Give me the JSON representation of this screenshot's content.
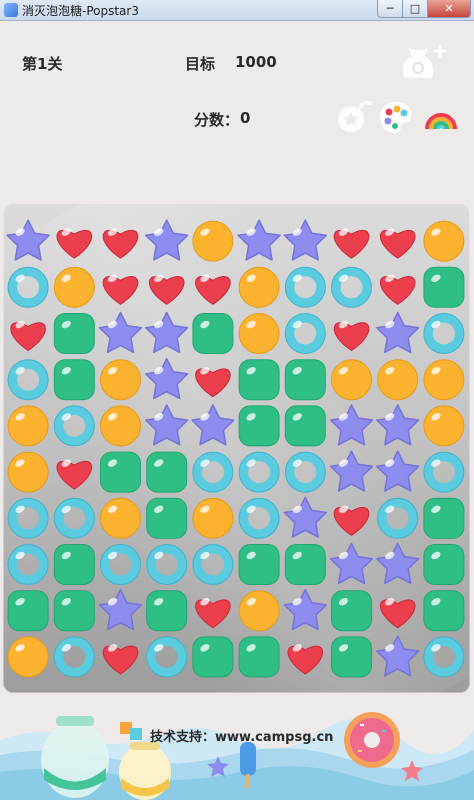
{
  "window": {
    "title": "消灭泡泡糖-Popstar3",
    "minimize_label": "─",
    "maximize_label": "□",
    "close_label": "✕"
  },
  "header": {
    "level": "第1关",
    "target_label": "目标",
    "target_value": "1000",
    "score_label": "分数：",
    "score_value": "0"
  },
  "tools": [
    {
      "name": "coin-bag-add-icon"
    },
    {
      "name": "bomb-icon"
    },
    {
      "name": "palette-icon"
    },
    {
      "name": "rainbow-icon"
    }
  ],
  "footer": {
    "credit": "技术支持：www.campsg.cn"
  },
  "colors": {
    "star": "#8f8cf0",
    "heart": "#ec3f4e",
    "orange": "#fbb22e",
    "ring": "#5bcbe0",
    "square": "#2fbf86"
  },
  "board": {
    "legend": {
      "S": "star",
      "H": "heart",
      "O": "orange",
      "R": "ring",
      "G": "square"
    },
    "rows": [
      [
        "S",
        "H",
        "H",
        "S",
        "O",
        "S",
        "S",
        "H",
        "H",
        "O"
      ],
      [
        "R",
        "O",
        "H",
        "H",
        "H",
        "O",
        "R",
        "R",
        "H",
        "G"
      ],
      [
        "H",
        "G",
        "S",
        "S",
        "G",
        "O",
        "R",
        "H",
        "S",
        "R"
      ],
      [
        "R",
        "G",
        "O",
        "S",
        "H",
        "G",
        "G",
        "O",
        "O",
        "O"
      ],
      [
        "O",
        "R",
        "O",
        "S",
        "S",
        "G",
        "G",
        "S",
        "S",
        "O"
      ],
      [
        "O",
        "H",
        "G",
        "G",
        "R",
        "R",
        "R",
        "S",
        "S",
        "R"
      ],
      [
        "R",
        "R",
        "O",
        "G",
        "O",
        "R",
        "S",
        "H",
        "R",
        "G"
      ],
      [
        "R",
        "G",
        "R",
        "R",
        "R",
        "G",
        "G",
        "S",
        "S",
        "G"
      ],
      [
        "G",
        "G",
        "S",
        "G",
        "H",
        "O",
        "S",
        "G",
        "H",
        "G"
      ],
      [
        "O",
        "R",
        "H",
        "R",
        "G",
        "G",
        "H",
        "G",
        "S",
        "R"
      ]
    ]
  }
}
